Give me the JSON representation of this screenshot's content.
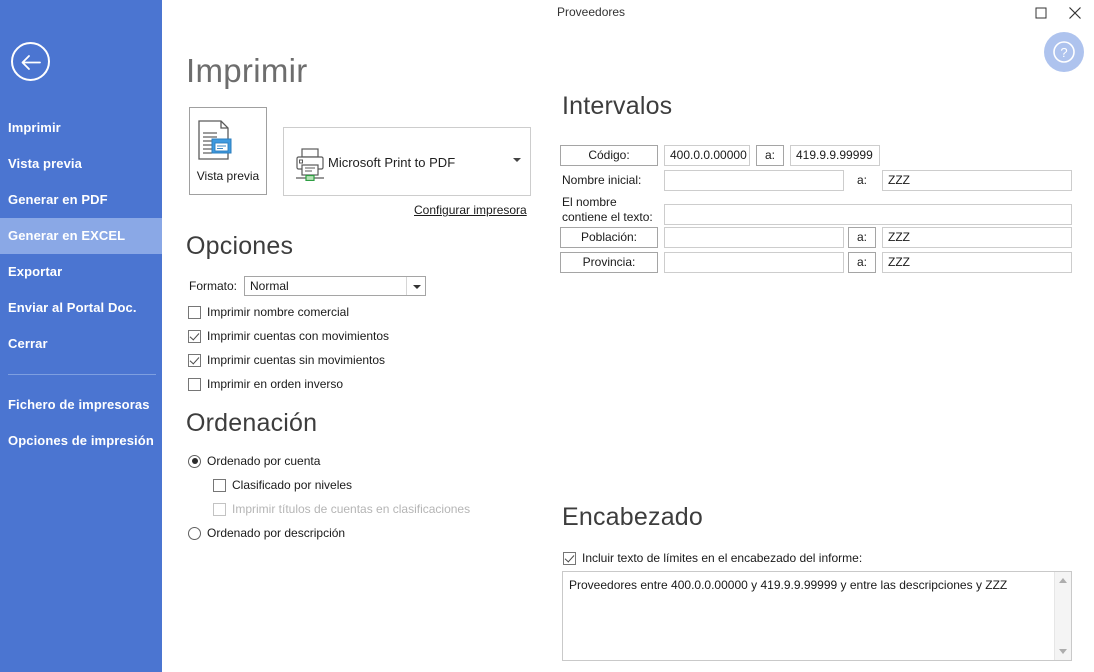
{
  "window": {
    "title": "Proveedores",
    "maximize_icon": "maximize-icon",
    "close_icon": "close-icon",
    "help_icon": "help-icon"
  },
  "sidebar": {
    "back_icon": "back-arrow-icon",
    "items": [
      {
        "label": "Imprimir",
        "active": false
      },
      {
        "label": "Vista previa",
        "active": false
      },
      {
        "label": "Generar en PDF",
        "active": false
      },
      {
        "label": "Generar en EXCEL",
        "active": true
      },
      {
        "label": "Exportar",
        "active": false
      },
      {
        "label": "Enviar al Portal Doc.",
        "active": false
      },
      {
        "label": "Cerrar",
        "active": false
      }
    ],
    "footer_items": [
      {
        "label": "Fichero de impresoras"
      },
      {
        "label": "Opciones de impresión"
      }
    ],
    "active_color": "#8aa8e6",
    "background_color": "#4b75d1"
  },
  "page": {
    "title": "Imprimir"
  },
  "printer": {
    "preview_button_label": "Vista previa",
    "preview_icon": "document-preview-icon",
    "printer_icon": "printer-icon",
    "selected_printer": "Microsoft Print to PDF",
    "dropdown_icon": "chevron-down-icon",
    "configure_link": "Configurar impresora"
  },
  "opciones": {
    "title": "Opciones",
    "formato_label": "Formato:",
    "formato_value": "Normal",
    "checkboxes": [
      {
        "label": "Imprimir nombre comercial",
        "checked": false,
        "disabled": false
      },
      {
        "label": "Imprimir cuentas con movimientos",
        "checked": true,
        "disabled": false
      },
      {
        "label": "Imprimir cuentas sin movimientos",
        "checked": true,
        "disabled": false
      },
      {
        "label": "Imprimir en orden inverso",
        "checked": false,
        "disabled": false
      }
    ]
  },
  "ordenacion": {
    "title": "Ordenación",
    "radio_cuenta": "Ordenado por cuenta",
    "sub_clasificado": "Clasificado por niveles",
    "sub_titulos": "Imprimir títulos de cuentas en clasificaciones",
    "radio_descripcion": "Ordenado por descripción",
    "selected": "cuenta",
    "clasificado_checked": false,
    "titulos_checked": false,
    "titulos_disabled": true
  },
  "intervalos": {
    "title": "Intervalos",
    "a_label": "a:",
    "rows": [
      {
        "label": "Código:",
        "from": "400.0.0.00000",
        "to": "419.9.9.99999",
        "boxed_label": true
      },
      {
        "label": "Nombre inicial:",
        "from": "",
        "to": "ZZZ",
        "boxed_label": false
      },
      {
        "label": "El nombre contiene el texto:",
        "from": "",
        "to": null,
        "boxed_label": false
      },
      {
        "label": "Población:",
        "from": "",
        "to": "ZZZ",
        "boxed_label": true
      },
      {
        "label": "Provincia:",
        "from": "",
        "to": "ZZZ",
        "boxed_label": true
      }
    ]
  },
  "encabezado": {
    "title": "Encabezado",
    "checkbox_label": "Incluir texto de límites en el encabezado del informe:",
    "checkbox_checked": true,
    "text": "Proveedores entre 400.0.0.00000 y 419.9.9.99999 y entre las descripciones  y ZZZ",
    "scroll_up_icon": "scroll-up-arrow-icon",
    "scroll_down_icon": "scroll-down-arrow-icon"
  }
}
